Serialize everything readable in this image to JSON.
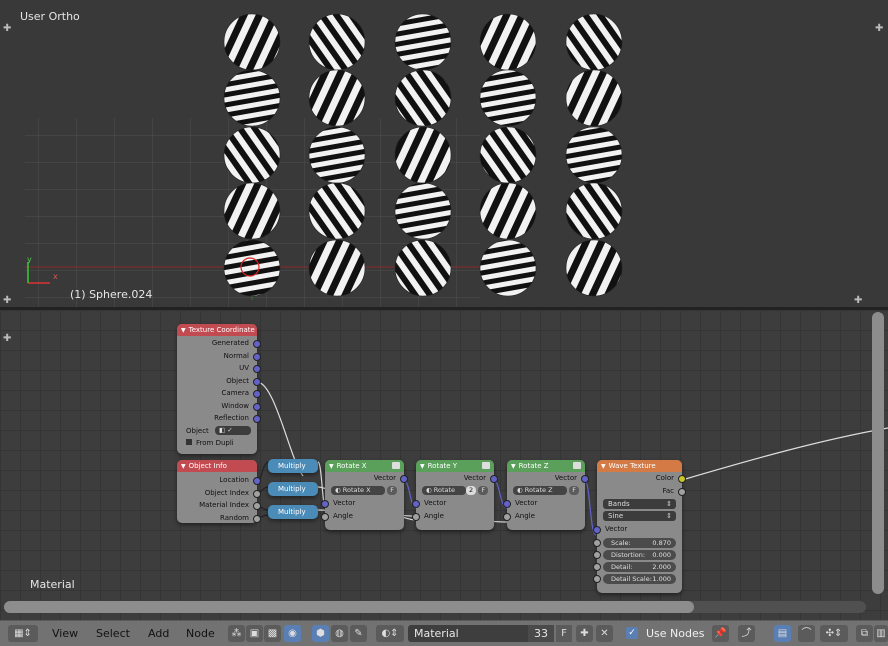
{
  "viewport": {
    "title": "User Ortho",
    "object_label": "(1) Sphere.024",
    "axis_labels": {
      "x": "x",
      "y": "y"
    }
  },
  "node_editor": {
    "label": "Material",
    "nodes": {
      "texture_coordinate": {
        "title": "Texture Coordinate",
        "outputs": [
          "Generated",
          "Normal",
          "UV",
          "Object",
          "Camera",
          "Window",
          "Reflection"
        ],
        "object_label": "Object",
        "from_dupli": "From Dupli",
        "color": "#c24b52"
      },
      "object_info": {
        "title": "Object Info",
        "outputs": [
          "Location",
          "Object Index",
          "Material Index",
          "Random"
        ],
        "color": "#c24b52"
      },
      "multiply": {
        "labels": [
          "Multiply",
          "Multiply",
          "Multiply"
        ],
        "color": "#4b8bb8"
      },
      "rotate_x": {
        "title": "Rotate X",
        "output": "Vector",
        "field": "Rotate X",
        "f": "F",
        "inputs": [
          "Vector",
          "Angle"
        ],
        "color": "#5aa05a"
      },
      "rotate_y": {
        "title": "Rotate Y",
        "output": "Vector",
        "field": "Rotate",
        "field_num": "2",
        "f": "F",
        "inputs": [
          "Vector",
          "Angle"
        ],
        "color": "#5aa05a"
      },
      "rotate_z": {
        "title": "Rotate Z",
        "output": "Vector",
        "field": "Rotate Z",
        "f": "F",
        "inputs": [
          "Vector",
          "Angle"
        ],
        "color": "#5aa05a"
      },
      "wave_texture": {
        "title": "Wave Texture",
        "outputs": [
          "Color",
          "Fac"
        ],
        "wave_type": "Bands",
        "profile": "Sine",
        "vector_label": "Vector",
        "params": [
          {
            "label": "Scale:",
            "value": "0.870"
          },
          {
            "label": "Distortion:",
            "value": "0.000"
          },
          {
            "label": "Detail:",
            "value": "2.000"
          },
          {
            "label": "Detail Scale:",
            "value": "1.000"
          }
        ],
        "color": "#d47a45"
      }
    }
  },
  "header": {
    "menus": [
      "View",
      "Select",
      "Add",
      "Node"
    ],
    "material_name": "Material",
    "users": "33",
    "fake_user": "F",
    "use_nodes_label": "Use Nodes",
    "use_nodes_checked": true
  }
}
